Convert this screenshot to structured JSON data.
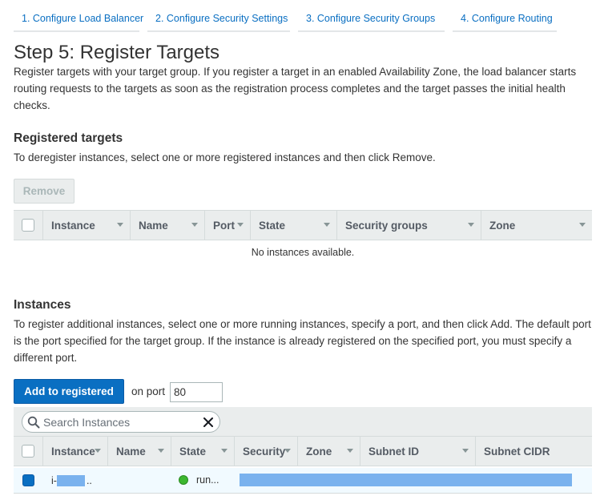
{
  "wizard_tabs": [
    {
      "label": "1. Configure Load Balancer"
    },
    {
      "label": "2. Configure Security Settings"
    },
    {
      "label": "3. Configure Security Groups"
    },
    {
      "label": "4. Configure Routing"
    }
  ],
  "page": {
    "title": "Step 5: Register Targets",
    "intro": "Register targets with your target group. If you register a target in an enabled Availability Zone, the load balancer starts routing requests to the targets as soon as the registration process completes and the target passes the initial health checks."
  },
  "registered": {
    "heading": "Registered targets",
    "description": "To deregister instances, select one or more registered instances and then click Remove.",
    "remove_label": "Remove",
    "columns": [
      "Instance",
      "Name",
      "Port",
      "State",
      "Security groups",
      "Zone"
    ],
    "empty_message": "No instances available."
  },
  "instances": {
    "heading": "Instances",
    "description": "To register additional instances, select one or more running instances, specify a port, and then click Add. The default port is the port specified for the target group. If the instance is already registered on the specified port, you must specify a different port.",
    "add_label": "Add to registered",
    "port_label": "on port",
    "port_value": "80",
    "search_placeholder": "Search Instances",
    "columns": [
      "Instance",
      "Name",
      "State",
      "Security",
      "Zone",
      "Subnet ID",
      "Subnet CIDR"
    ],
    "rows": [
      {
        "instance_prefix": "i-",
        "instance_suffix": "..",
        "state": "run...",
        "selected": true
      }
    ]
  },
  "colors": {
    "accent": "#0a6fc2",
    "running": "#3cb72f",
    "redaction": "#7ab2ee"
  },
  "icons": [
    "search-icon",
    "close-icon",
    "caret-down-icon",
    "status-running-icon"
  ]
}
